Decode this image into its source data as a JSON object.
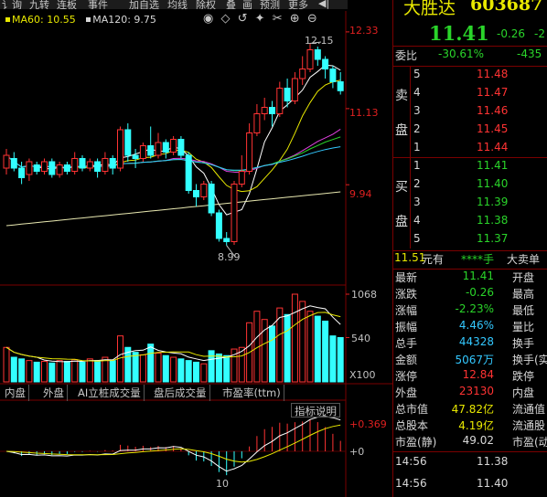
{
  "toolbar": {
    "items": [
      "讠询",
      "九转",
      "连板",
      "事件",
      "加自选",
      "均线",
      "除权",
      "叠",
      "画",
      "预测",
      "更多"
    ]
  },
  "ma_legend": {
    "ma60_label": "MA60: 10.55",
    "ma120_label": "MA120: 9.75",
    "ma60_color": "#e8e800",
    "ma120_color": "#d8d8d8"
  },
  "price_axis": {
    "top": "12.33",
    "mid": "11.13",
    "low": "9.94"
  },
  "annotations": {
    "high": "12.15",
    "low": "8.99"
  },
  "volume_axis": {
    "top": "1068",
    "mid": "540",
    "unit": "X100"
  },
  "macd_axis": {
    "top": "+0.369",
    "zero": "+0"
  },
  "bottom_tabs": [
    "内盘",
    "外盘",
    "AI立桩成交量",
    "盘后成交量",
    "市盈率(ttm)"
  ],
  "indicator_button": "指标说明",
  "x_axis_label": "10",
  "stock": {
    "name": "大胜达",
    "code": "603687",
    "price": "11.41",
    "change": "-0.26",
    "change_extra": "-2"
  },
  "weibi": {
    "label": "委比",
    "ratio": "-30.61%",
    "diff": "-435"
  },
  "sell_orders": [
    {
      "level": "5",
      "price": "11.48"
    },
    {
      "level": "4",
      "price": "11.47"
    },
    {
      "level": "3",
      "price": "11.46"
    },
    {
      "level": "2",
      "price": "11.45"
    },
    {
      "level": "1",
      "price": "11.44"
    }
  ],
  "sell_label": [
    "卖",
    "盘"
  ],
  "buy_orders": [
    {
      "level": "1",
      "price": "11.41"
    },
    {
      "level": "2",
      "price": "11.40"
    },
    {
      "level": "3",
      "price": "11.39"
    },
    {
      "level": "4",
      "price": "11.38"
    },
    {
      "level": "5",
      "price": "11.37"
    }
  ],
  "buy_label": [
    "买",
    "盘"
  ],
  "big_order": {
    "prefix": "11.51",
    "unit": "元有",
    "stars": "****手",
    "label": "大卖单"
  },
  "stats": [
    {
      "l1": "最新",
      "v1": "11.41",
      "c1": "dn",
      "l2": "开盘"
    },
    {
      "l1": "涨跌",
      "v1": "-0.26",
      "c1": "dn",
      "l2": "最高"
    },
    {
      "l1": "涨幅",
      "v1": "-2.23%",
      "c1": "dn",
      "l2": "最低"
    },
    {
      "l1": "振幅",
      "v1": "4.46%",
      "c1": "cy",
      "l2": "量比"
    },
    {
      "l1": "总手",
      "v1": "44328",
      "c1": "cy",
      "l2": "换手"
    },
    {
      "l1": "金额",
      "v1": "5067万",
      "c1": "cy",
      "l2": "换手(实"
    },
    {
      "l1": "涨停",
      "v1": "12.84",
      "c1": "up",
      "l2": "跌停"
    },
    {
      "l1": "外盘",
      "v1": "23130",
      "c1": "up",
      "l2": "内盘"
    },
    {
      "l1": "总市值",
      "v1": "47.82亿",
      "c1": "yl",
      "l2": "流通值"
    },
    {
      "l1": "总股本",
      "v1": "4.19亿",
      "c1": "yl",
      "l2": "流通股"
    },
    {
      "l1": "市盈(静)",
      "v1": "49.02",
      "c1": "wh",
      "l2": "市盈(动"
    }
  ],
  "ticks": [
    {
      "time": "14:56",
      "price": "11.38"
    },
    {
      "time": "14:56",
      "price": "11.40"
    }
  ],
  "chart_data": {
    "type": "candlestick",
    "ylim": [
      8.9,
      12.4
    ],
    "candles": [
      {
        "o": 10.2,
        "c": 10.4,
        "h": 10.5,
        "l": 10.1
      },
      {
        "o": 10.35,
        "c": 10.2,
        "h": 10.45,
        "l": 10.15
      },
      {
        "o": 10.2,
        "c": 10.05,
        "h": 10.3,
        "l": 9.95
      },
      {
        "o": 10.1,
        "c": 10.3,
        "h": 10.35,
        "l": 10.0
      },
      {
        "o": 10.25,
        "c": 10.15,
        "h": 10.3,
        "l": 10.1
      },
      {
        "o": 10.15,
        "c": 10.3,
        "h": 10.35,
        "l": 10.1
      },
      {
        "o": 10.3,
        "c": 10.1,
        "h": 10.35,
        "l": 10.05
      },
      {
        "o": 10.1,
        "c": 10.25,
        "h": 10.3,
        "l": 10.05
      },
      {
        "o": 10.25,
        "c": 10.15,
        "h": 10.3,
        "l": 10.1
      },
      {
        "o": 10.15,
        "c": 10.35,
        "h": 10.45,
        "l": 10.1
      },
      {
        "o": 10.35,
        "c": 10.2,
        "h": 10.4,
        "l": 10.15
      },
      {
        "o": 10.2,
        "c": 10.3,
        "h": 10.35,
        "l": 10.15
      },
      {
        "o": 10.3,
        "c": 10.15,
        "h": 10.35,
        "l": 10.05
      },
      {
        "o": 10.15,
        "c": 10.35,
        "h": 10.45,
        "l": 10.1
      },
      {
        "o": 10.35,
        "c": 10.2,
        "h": 10.4,
        "l": 10.1
      },
      {
        "o": 10.2,
        "c": 10.8,
        "h": 10.85,
        "l": 10.15
      },
      {
        "o": 10.8,
        "c": 10.4,
        "h": 10.9,
        "l": 10.3
      },
      {
        "o": 10.4,
        "c": 10.35,
        "h": 10.5,
        "l": 10.2
      },
      {
        "o": 10.35,
        "c": 10.55,
        "h": 10.6,
        "l": 10.3
      },
      {
        "o": 10.55,
        "c": 10.4,
        "h": 10.85,
        "l": 10.35
      },
      {
        "o": 10.4,
        "c": 10.6,
        "h": 10.75,
        "l": 10.35
      },
      {
        "o": 10.6,
        "c": 10.45,
        "h": 10.65,
        "l": 10.35
      },
      {
        "o": 10.45,
        "c": 10.65,
        "h": 10.7,
        "l": 10.4
      },
      {
        "o": 10.65,
        "c": 10.4,
        "h": 10.7,
        "l": 10.35
      },
      {
        "o": 10.4,
        "c": 9.85,
        "h": 10.45,
        "l": 9.8
      },
      {
        "o": 9.85,
        "c": 9.75,
        "h": 9.95,
        "l": 9.6
      },
      {
        "o": 9.75,
        "c": 9.95,
        "h": 10.0,
        "l": 9.7
      },
      {
        "o": 9.95,
        "c": 9.5,
        "h": 10.0,
        "l": 9.45
      },
      {
        "o": 9.5,
        "c": 9.1,
        "h": 9.55,
        "l": 9.05
      },
      {
        "o": 9.1,
        "c": 9.05,
        "h": 9.2,
        "l": 8.99
      },
      {
        "o": 9.05,
        "c": 9.95,
        "h": 10.0,
        "l": 9.0
      },
      {
        "o": 9.95,
        "c": 10.15,
        "h": 10.4,
        "l": 9.9
      },
      {
        "o": 10.15,
        "c": 10.75,
        "h": 10.9,
        "l": 10.1
      },
      {
        "o": 10.75,
        "c": 11.05,
        "h": 11.2,
        "l": 10.7
      },
      {
        "o": 11.05,
        "c": 11.15,
        "h": 11.3,
        "l": 10.95
      },
      {
        "o": 11.15,
        "c": 11.05,
        "h": 11.25,
        "l": 10.85
      },
      {
        "o": 11.05,
        "c": 11.45,
        "h": 11.55,
        "l": 11.0
      },
      {
        "o": 11.45,
        "c": 11.25,
        "h": 11.6,
        "l": 11.15
      },
      {
        "o": 11.25,
        "c": 11.6,
        "h": 11.7,
        "l": 11.2
      },
      {
        "o": 11.6,
        "c": 11.75,
        "h": 11.95,
        "l": 11.5
      },
      {
        "o": 11.75,
        "c": 12.05,
        "h": 12.15,
        "l": 11.7
      },
      {
        "o": 12.05,
        "c": 11.9,
        "h": 12.1,
        "l": 11.8
      },
      {
        "o": 11.9,
        "c": 11.75,
        "h": 11.95,
        "l": 11.6
      },
      {
        "o": 11.75,
        "c": 11.55,
        "h": 11.8,
        "l": 11.45
      },
      {
        "o": 11.55,
        "c": 11.41,
        "h": 11.7,
        "l": 11.35
      }
    ],
    "volumes": [
      420,
      300,
      280,
      260,
      240,
      250,
      230,
      260,
      250,
      270,
      240,
      280,
      260,
      300,
      260,
      560,
      420,
      360,
      330,
      460,
      350,
      320,
      300,
      280,
      260,
      240,
      220,
      380,
      340,
      320,
      400,
      420,
      720,
      860,
      760,
      680,
      900,
      820,
      1068,
      980,
      860,
      800,
      740,
      560,
      540
    ],
    "volume_ylim": [
      0,
      1068
    ],
    "macd_ylim": [
      -0.2,
      0.369
    ]
  }
}
